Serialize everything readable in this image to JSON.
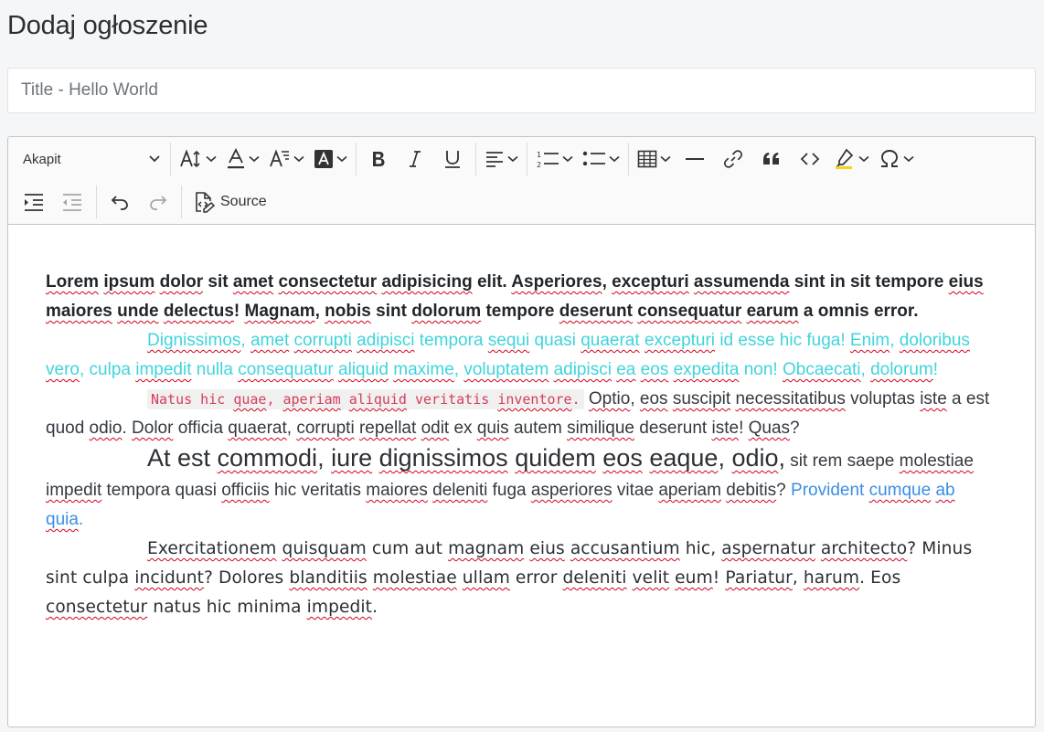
{
  "page": {
    "title": "Dodaj ogłoszenie"
  },
  "title_input": {
    "placeholder": "Title - Hello World",
    "value": ""
  },
  "toolbar": {
    "paragraph_select": "Akapit",
    "source_label": "Source",
    "icons": [
      "font-size-icon",
      "font-color-icon",
      "font-family-icon",
      "font-background-color-icon",
      "bold-icon",
      "italic-icon",
      "underline-icon",
      "align-icon",
      "numbered-list-icon",
      "bulleted-list-icon",
      "table-icon",
      "horizontal-line-icon",
      "link-icon",
      "blockquote-icon",
      "code-icon",
      "highlight-icon",
      "special-characters-icon",
      "indent-icon",
      "outdent-icon",
      "undo-icon",
      "redo-icon",
      "source-icon"
    ]
  },
  "content": {
    "p1": [
      "",
      "Lorem",
      " ",
      "ipsum",
      " ",
      "dolor",
      " sit ",
      "amet",
      " ",
      "consectetur",
      " ",
      "adipisicing",
      " elit. ",
      "Asperiores",
      ", ",
      "excepturi",
      " ",
      "assumenda",
      " sint in sit tempore ",
      "eius",
      " ",
      "maiores",
      " ",
      "unde",
      " ",
      "delectus",
      "! ",
      "Magnam",
      ", ",
      "nobis",
      " sint ",
      "dolorum",
      " tempore ",
      "deserunt",
      " ",
      "consequatur",
      " ",
      "earum",
      " a omnis error."
    ],
    "p2": [
      "",
      "Dignissimos",
      ", ",
      "amet",
      " ",
      "corrupti",
      " ",
      "adipisci",
      " tempora ",
      "sequi",
      " quasi ",
      "quaerat",
      " ",
      "excepturi",
      " id esse hic fuga! ",
      "Enim",
      ", ",
      "doloribus",
      " ",
      "vero",
      ", culpa ",
      "impedit",
      " nulla ",
      "consequatur",
      " ",
      "aliquid",
      " ",
      "maxime",
      ", ",
      "voluptatem",
      " ",
      "adipisci",
      " ",
      "ea",
      " ",
      "eos",
      " ",
      "expedita",
      " non! ",
      "Obcaecati",
      ", ",
      "dolorum",
      "!"
    ],
    "p3_code": [
      "Natus hic ",
      "quae",
      ", ",
      "aperiam",
      " ",
      "aliquid",
      " veritatis ",
      "inventore",
      "."
    ],
    "p3_text": [
      " ",
      "Optio",
      ", ",
      "eos",
      " ",
      "suscipit",
      " ",
      "necessitatibus",
      " voluptas ",
      "iste",
      " a est quod ",
      "odio",
      ". ",
      "Dolor",
      " officia ",
      "quaerat",
      ", ",
      "corrupti",
      " ",
      "repellat",
      " ",
      "odit",
      " ex ",
      "quis",
      " autem ",
      "similique",
      " deserunt ",
      "iste",
      "! ",
      "Quas",
      "?"
    ],
    "p4_big": [
      "At est ",
      "commodi",
      ", ",
      "iure",
      " ",
      "dignissimos",
      " ",
      "quidem",
      " ",
      "eos",
      " ",
      "eaque",
      ", ",
      "odio",
      ","
    ],
    "p4_small": [
      " sit rem saepe ",
      "molestiae",
      " ",
      "impedit",
      " tempora quasi ",
      "officiis",
      " hic veritatis ",
      "maiores",
      " ",
      "deleniti",
      " fuga ",
      "asperiores",
      " vitae ",
      "aperiam",
      " ",
      "debitis",
      "? "
    ],
    "p4_blue": [
      "Provident ",
      "cumque",
      " ",
      "ab",
      " ",
      "quia",
      "."
    ],
    "p5": [
      "",
      "Exercitationem",
      " ",
      "quisquam",
      " cum aut ",
      "magnam",
      " ",
      "eius",
      " ",
      "accusantium",
      " hic, ",
      "aspernatur",
      " ",
      "architecto",
      "? Minus sint culpa ",
      "incidunt",
      "? Dolores ",
      "blanditiis",
      " ",
      "molestiae",
      " ",
      "ullam",
      " error ",
      "deleniti",
      " ",
      "velit",
      " ",
      "eum",
      "! ",
      "Pariatur",
      ", ",
      "harum",
      ". Eos ",
      "consectetur",
      " natus hic minima ",
      "impedit",
      "."
    ]
  }
}
